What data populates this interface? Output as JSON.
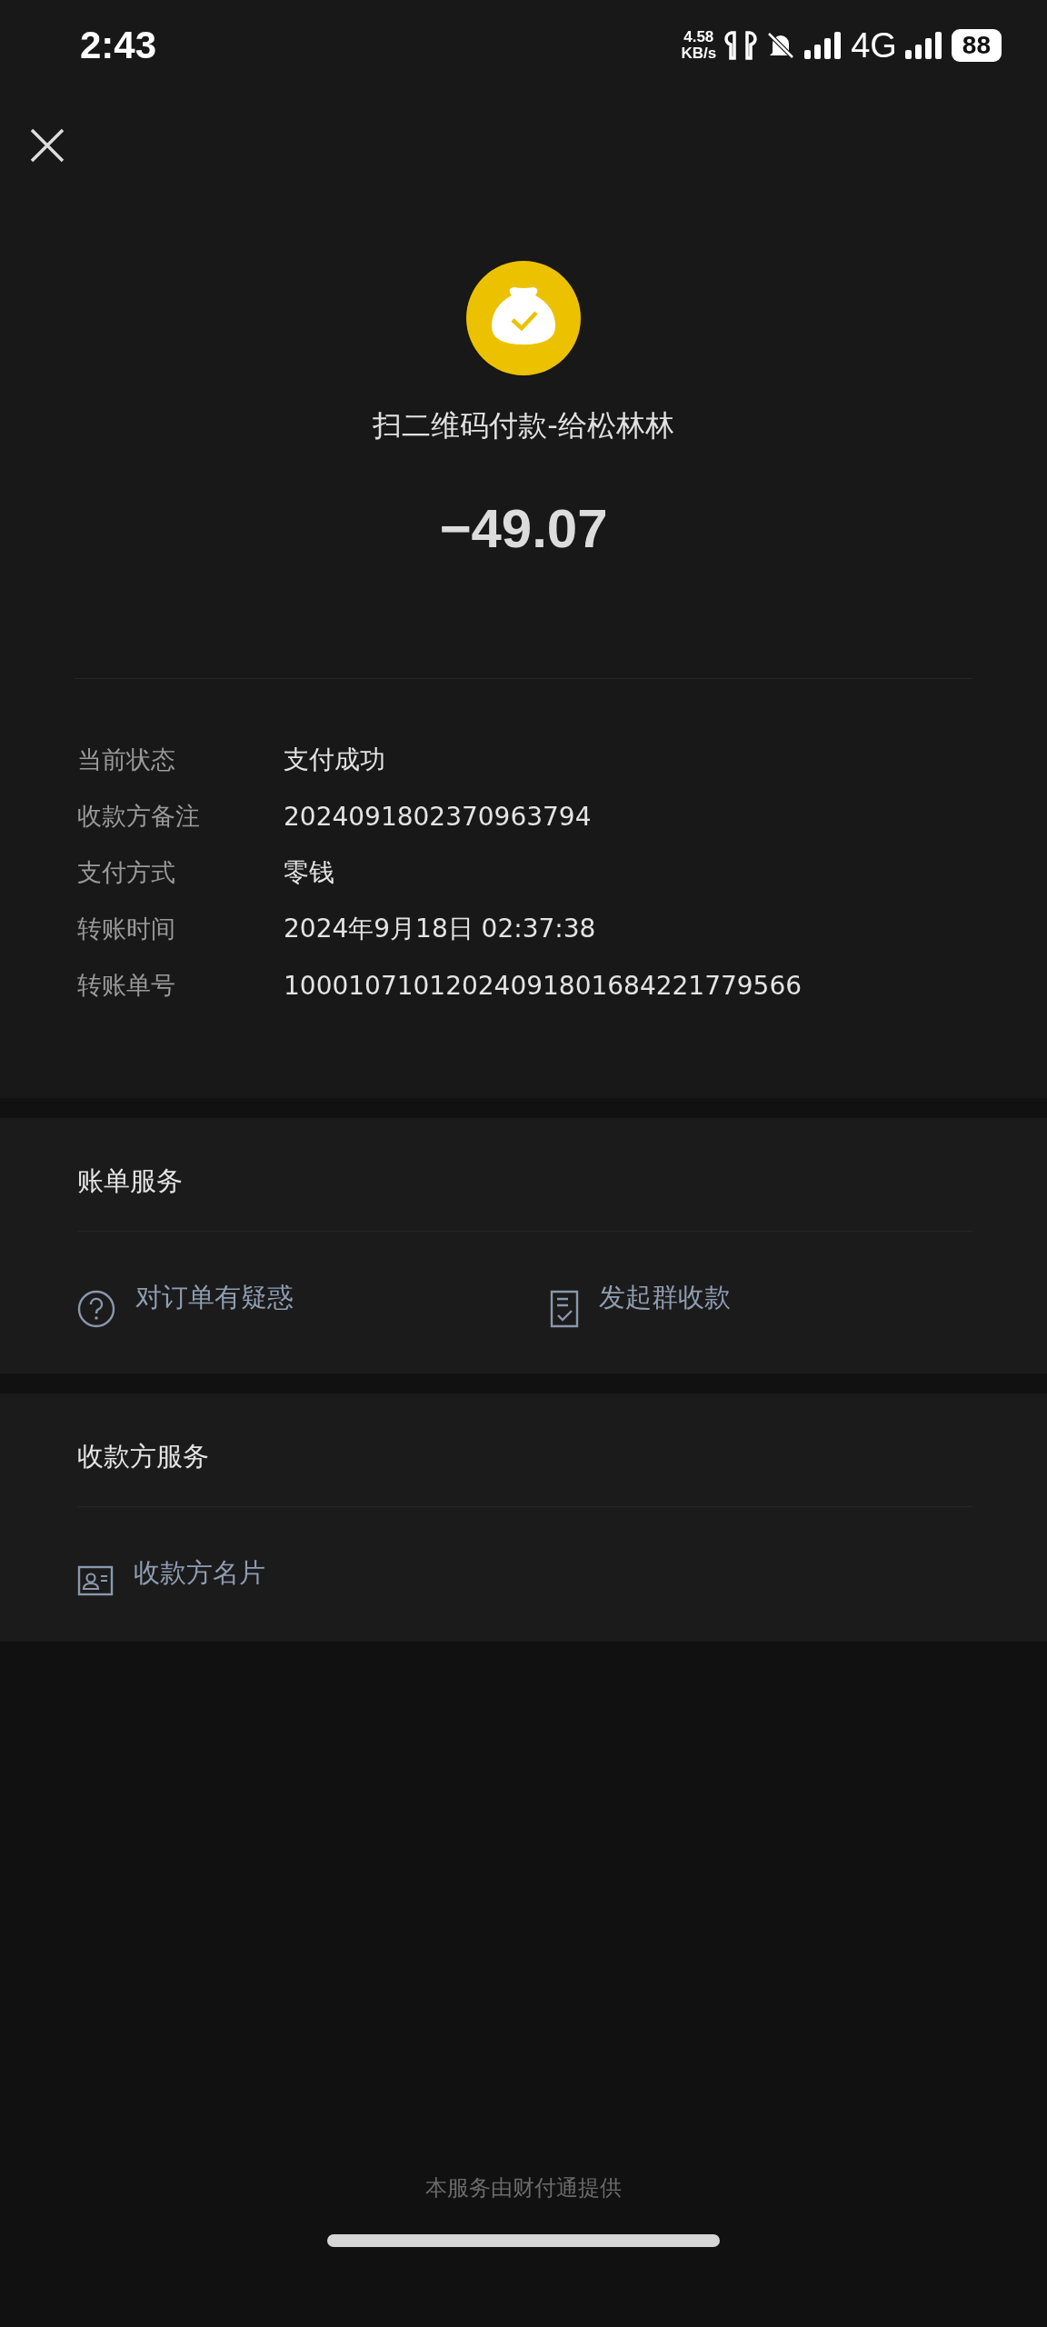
{
  "status_bar": {
    "time": "2:43",
    "speed_value": "4.58",
    "speed_unit": "KB/s",
    "network": "4G",
    "battery": "88"
  },
  "header": {
    "title": "扫二维码付款-给松林林",
    "amount": "−49.07"
  },
  "details": [
    {
      "label": "当前状态",
      "value": "支付成功"
    },
    {
      "label": "收款方备注",
      "value": "2024091802370963794"
    },
    {
      "label": "支付方式",
      "value": "零钱"
    },
    {
      "label": "转账时间",
      "value": "2024年9月18日 02:37:38"
    },
    {
      "label": "转账单号",
      "value": "10001071012024091801684221779566"
    }
  ],
  "sections": [
    {
      "title": "账单服务",
      "items": [
        {
          "kind": "question",
          "label": "对订单有疑惑"
        },
        {
          "kind": "checklist",
          "label": "发起群收款"
        }
      ]
    },
    {
      "title": "收款方服务",
      "items": [
        {
          "kind": "contact-card",
          "label": "收款方名片"
        }
      ]
    }
  ],
  "footer": "本服务由财付通提供"
}
